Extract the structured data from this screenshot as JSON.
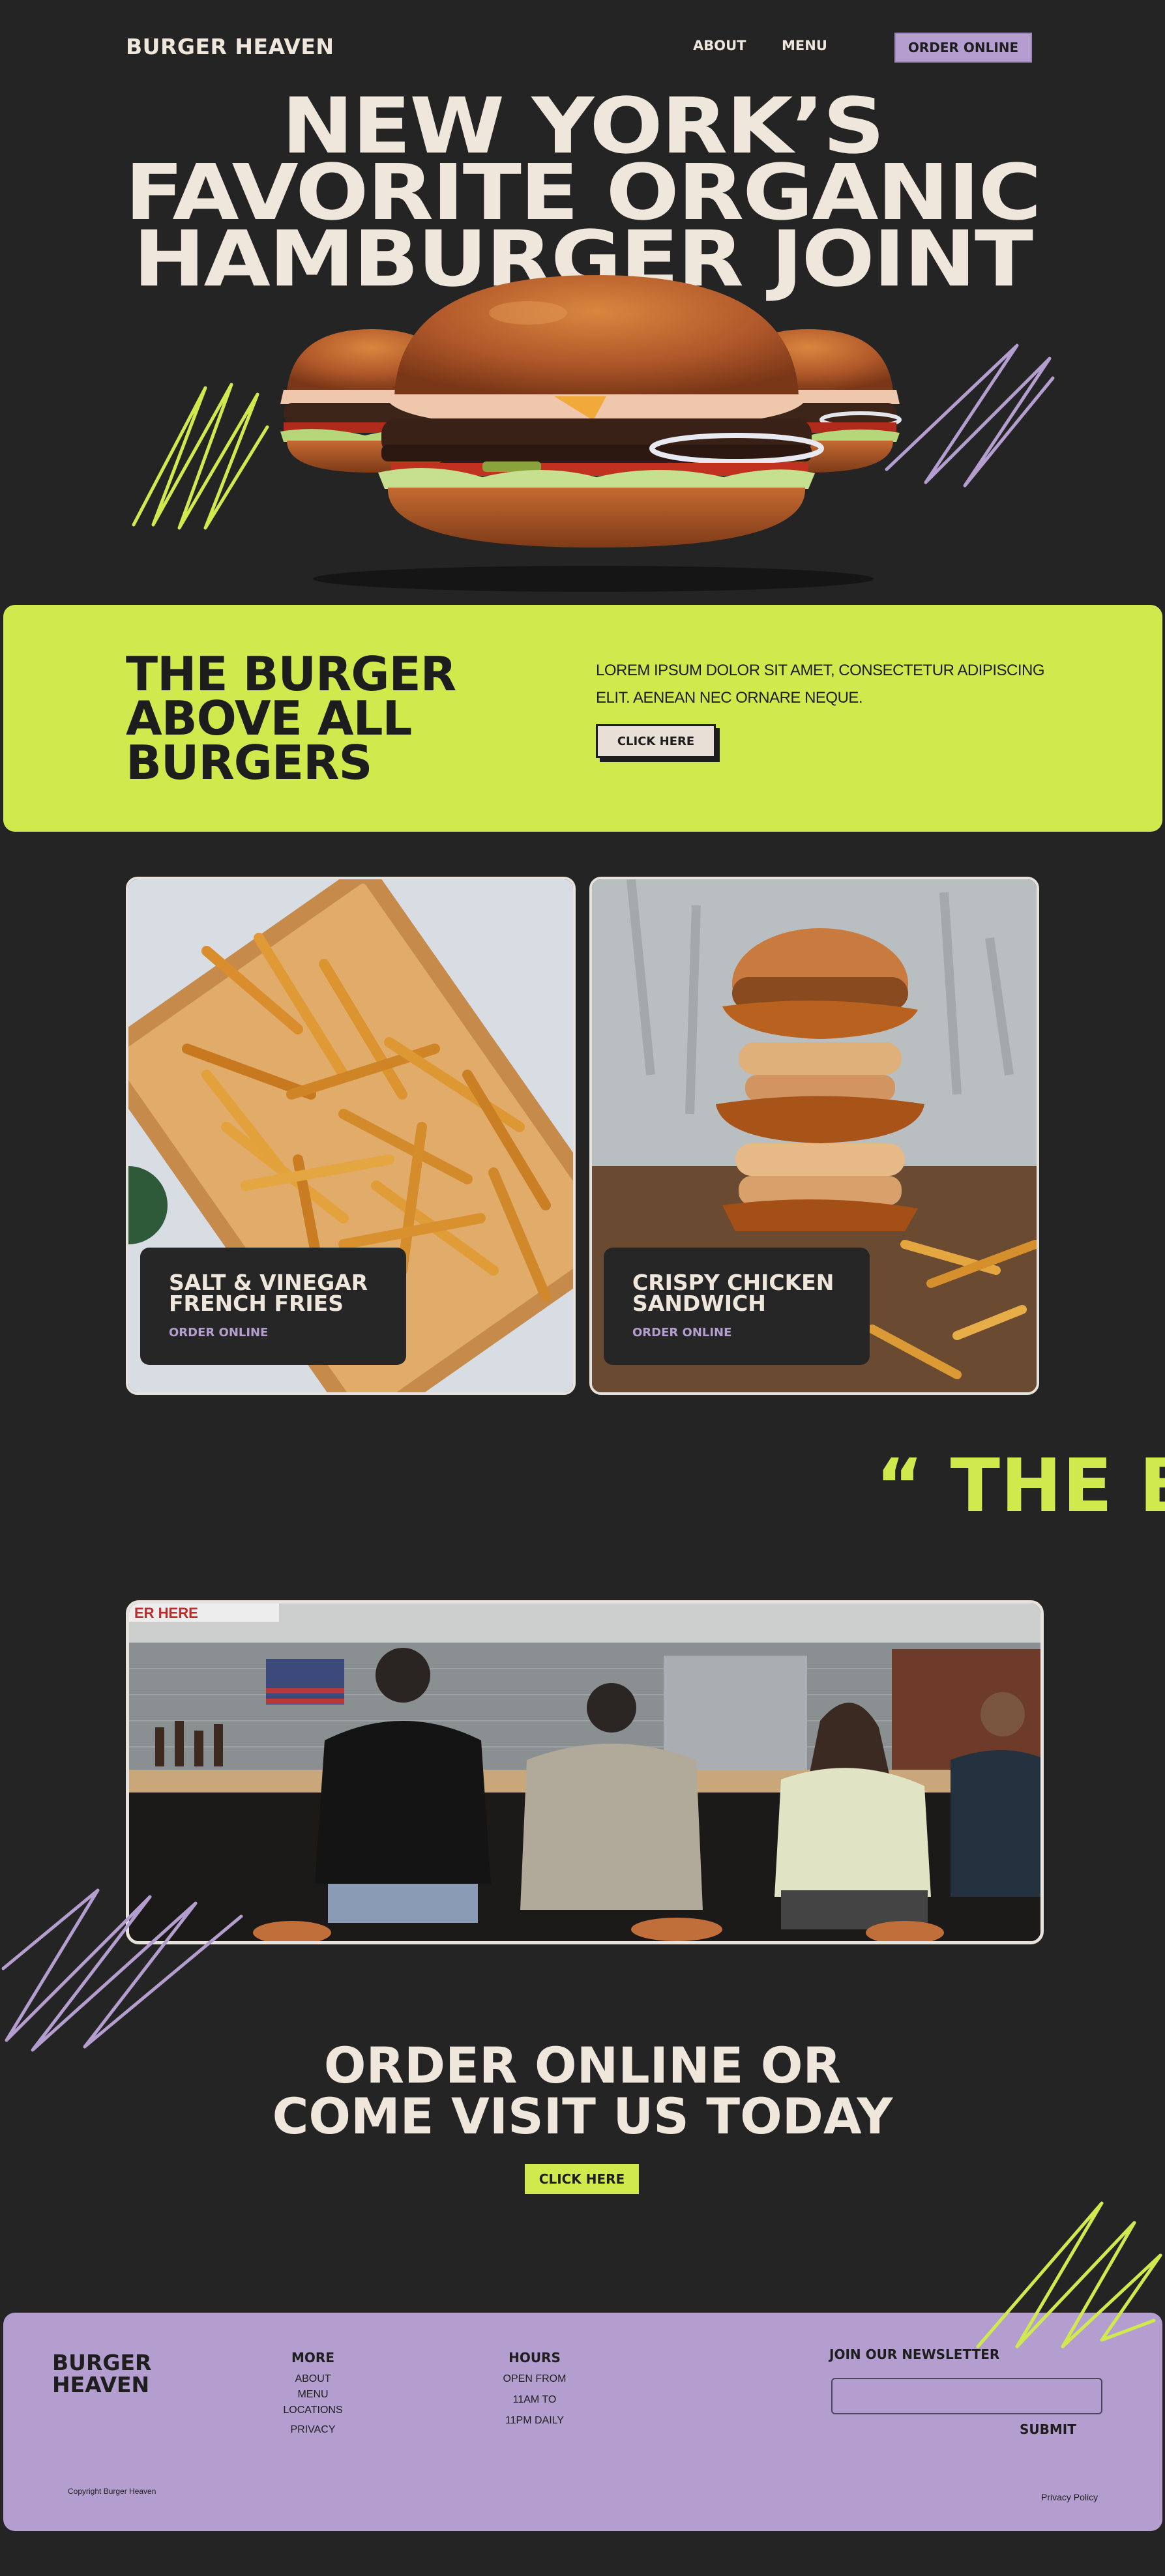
{
  "header": {
    "logo": "BURGER HEAVEN",
    "nav": [
      "ABOUT",
      "MENU"
    ],
    "order_button": "ORDER ONLINE"
  },
  "hero": {
    "title_lines": [
      "NEW YORK’S",
      "FAVORITE ORGANIC",
      "HAMBURGER JOINT"
    ]
  },
  "intro": {
    "title_lines": [
      "THE BURGER",
      "ABOVE ALL",
      "BURGERS"
    ],
    "text_lines": [
      "LOREM IPSUM DOLOR SIT AMET, CONSECTETUR ADIPISCING",
      "ELIT. AENEAN NEC ORNARE NEQUE."
    ],
    "button": "CLICK HERE"
  },
  "menu_cards": [
    {
      "title_lines": [
        "SALT & VINEGAR",
        "FRENCH FRIES"
      ],
      "link": "ORDER ONLINE"
    },
    {
      "title_lines": [
        "CRISPY CHICKEN",
        "SANDWICH"
      ],
      "link": "ORDER ONLINE"
    }
  ],
  "quote_text": "“ THE B",
  "diner_sign": "ER HERE",
  "cta": {
    "title_lines": [
      "ORDER ONLINE OR",
      "COME VISIT US TODAY"
    ],
    "button": "CLICK HERE"
  },
  "footer": {
    "logo_lines": [
      "BURGER",
      "HEAVEN"
    ],
    "more": {
      "heading": "MORE",
      "items": [
        "ABOUT",
        "MENU",
        "LOCATIONS",
        "PRIVACY"
      ]
    },
    "hours": {
      "heading": "HOURS",
      "items": [
        "OPEN FROM",
        "11AM TO",
        "11PM DAILY"
      ]
    },
    "newsletter": {
      "heading": "JOIN OUR NEWSLETTER",
      "placeholder": "",
      "submit": "SUBMIT"
    },
    "copyright": "Copyright Burger Heaven",
    "privacy": "Privacy Policy"
  },
  "colors": {
    "background": "#242424",
    "lime": "#d0ea4e",
    "lavender": "#b39ecf",
    "cream": "#efe6dc"
  }
}
